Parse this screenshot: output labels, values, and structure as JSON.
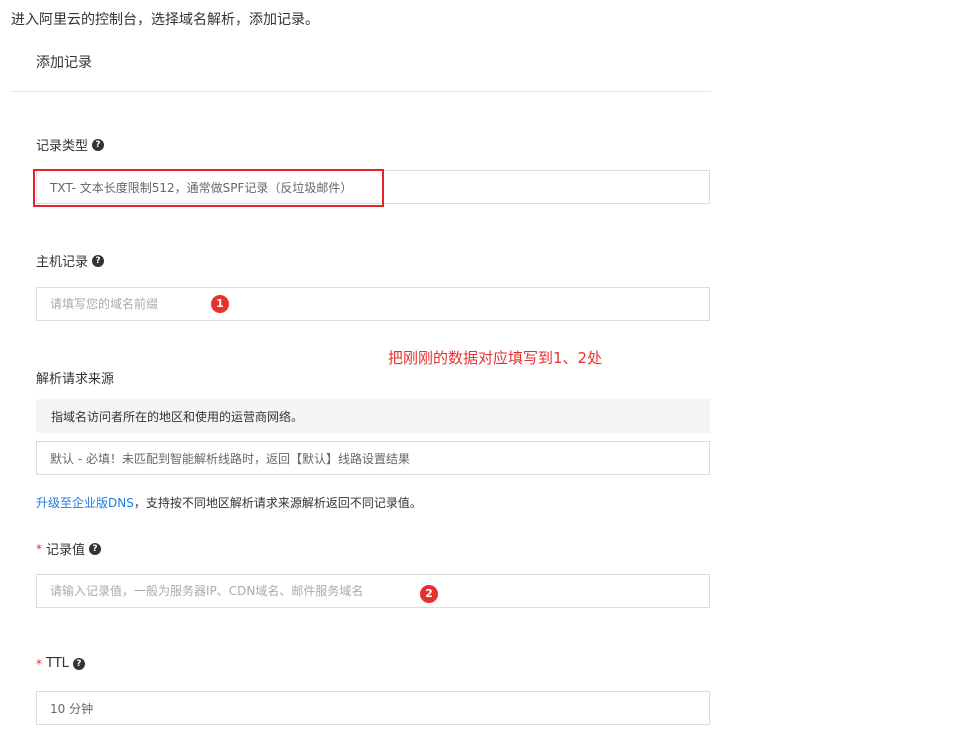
{
  "article": {
    "intro": "进入阿里云的控制台，选择域名解析，添加记录。"
  },
  "panel": {
    "title": "添加记录"
  },
  "record_type": {
    "label": "记录类型",
    "value": "TXT- 文本长度限制512，通常做SPF记录（反垃圾邮件）"
  },
  "host_record": {
    "label": "主机记录",
    "placeholder": "请填写您的域名前缀",
    "marker": "1"
  },
  "annotation": "把刚刚的数据对应填写到1、2处",
  "request_source": {
    "label": "解析请求来源",
    "info": "指域名访问者所在的地区和使用的运营商网络。",
    "value": "默认 - 必填！未匹配到智能解析线路时，返回【默认】线路设置结果"
  },
  "upgrade": {
    "link": "升级至企业版DNS",
    "text": "，支持按不同地区解析请求来源解析返回不同记录值。"
  },
  "record_value": {
    "required_mark": "*",
    "label": "记录值",
    "placeholder": "请输入记录值，一般为服务器IP、CDN域名、邮件服务域名",
    "marker": "2"
  },
  "ttl": {
    "required_mark": "*",
    "label": "TTL",
    "value": "10 分钟"
  },
  "icons": {
    "help": "?"
  },
  "colors": {
    "annotation_red": "#e8312f",
    "link_blue": "#1e7de0",
    "required_red": "#e62e2e"
  }
}
